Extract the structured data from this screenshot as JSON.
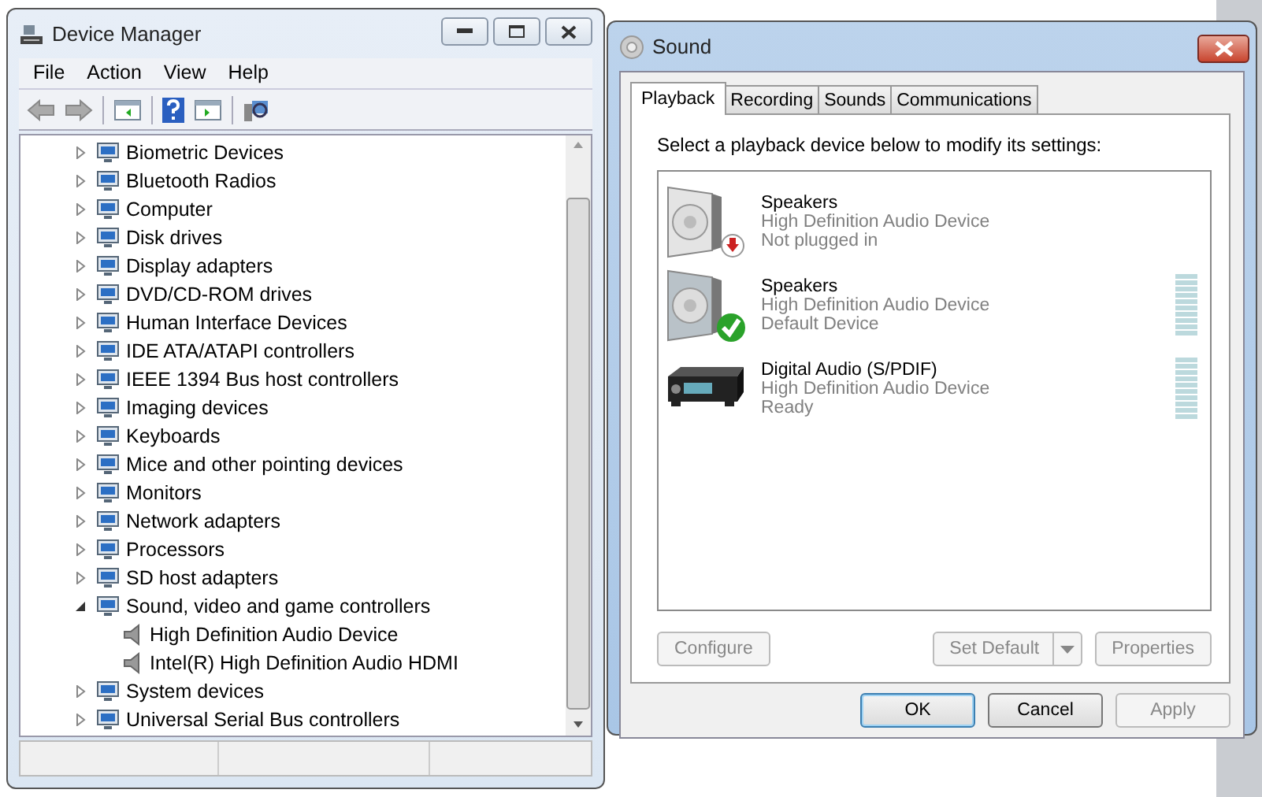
{
  "device_manager": {
    "title": "Device Manager",
    "menu": [
      "File",
      "Action",
      "View",
      "Help"
    ],
    "tree": [
      {
        "label": "Biometric Devices",
        "expanded": false
      },
      {
        "label": "Bluetooth Radios",
        "expanded": false
      },
      {
        "label": "Computer",
        "expanded": false
      },
      {
        "label": "Disk drives",
        "expanded": false
      },
      {
        "label": "Display adapters",
        "expanded": false
      },
      {
        "label": "DVD/CD-ROM drives",
        "expanded": false
      },
      {
        "label": "Human Interface Devices",
        "expanded": false
      },
      {
        "label": "IDE ATA/ATAPI controllers",
        "expanded": false
      },
      {
        "label": "IEEE 1394 Bus host controllers",
        "expanded": false
      },
      {
        "label": "Imaging devices",
        "expanded": false
      },
      {
        "label": "Keyboards",
        "expanded": false
      },
      {
        "label": "Mice and other pointing devices",
        "expanded": false
      },
      {
        "label": "Monitors",
        "expanded": false
      },
      {
        "label": "Network adapters",
        "expanded": false
      },
      {
        "label": "Processors",
        "expanded": false
      },
      {
        "label": "SD host adapters",
        "expanded": false
      },
      {
        "label": "Sound, video and game controllers",
        "expanded": true,
        "children": [
          {
            "label": "High Definition Audio Device"
          },
          {
            "label": "Intel(R) High Definition Audio HDMI"
          }
        ]
      },
      {
        "label": "System devices",
        "expanded": false
      },
      {
        "label": "Universal Serial Bus controllers",
        "expanded": false
      }
    ]
  },
  "sound": {
    "title": "Sound",
    "tabs": [
      {
        "label": "Playback",
        "selected": true
      },
      {
        "label": "Recording",
        "selected": false
      },
      {
        "label": "Sounds",
        "selected": false
      },
      {
        "label": "Communications",
        "selected": false
      }
    ],
    "instruction": "Select a playback device below to modify its settings:",
    "devices": [
      {
        "kind": "speaker",
        "name": "Speakers",
        "driver": "High Definition Audio Device",
        "status": "Not plugged in",
        "unplugged": true,
        "default": false,
        "meter": false
      },
      {
        "kind": "speaker",
        "name": "Speakers",
        "driver": "High Definition Audio Device",
        "status": "Default Device",
        "unplugged": false,
        "default": true,
        "meter": true
      },
      {
        "kind": "receiver",
        "name": "Digital Audio (S/PDIF)",
        "driver": "High Definition Audio Device",
        "status": "Ready",
        "unplugged": false,
        "default": false,
        "meter": true
      }
    ],
    "device_buttons": [
      {
        "label": "Configure",
        "disabled": true,
        "split": false
      },
      {
        "label": "Set Default",
        "disabled": true,
        "split": true
      },
      {
        "label": "Properties",
        "disabled": true,
        "split": false
      }
    ],
    "dialog_buttons": [
      {
        "label": "OK",
        "disabled": false,
        "default": true
      },
      {
        "label": "Cancel",
        "disabled": false,
        "default": false
      },
      {
        "label": "Apply",
        "disabled": true,
        "default": false
      }
    ]
  }
}
